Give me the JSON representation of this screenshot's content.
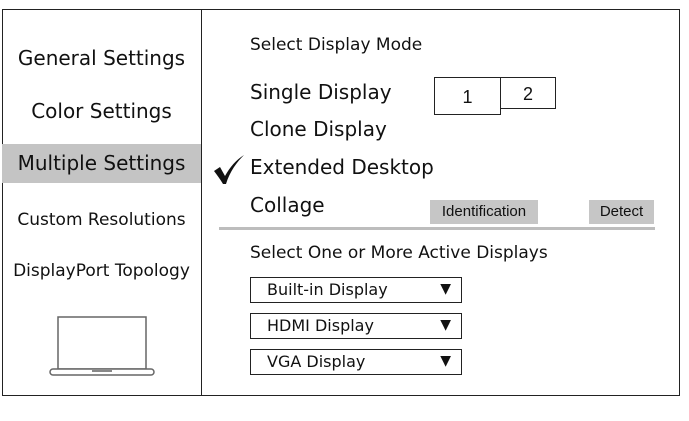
{
  "sidebar": {
    "items": [
      {
        "label": "General Settings"
      },
      {
        "label": "Color Settings"
      },
      {
        "label": "Multiple Settings"
      },
      {
        "label": "Custom Resolutions"
      },
      {
        "label": "DisplayPort Topology"
      }
    ],
    "active_index": 2,
    "icon": "laptop-icon"
  },
  "main": {
    "mode_heading": "Select Display Mode",
    "modes": [
      {
        "label": "Single Display"
      },
      {
        "label": "Clone Display"
      },
      {
        "label": "Extended Desktop",
        "selected": true
      },
      {
        "label": "Collage"
      }
    ],
    "displays": [
      "1",
      "2"
    ],
    "identification_label": "Identification",
    "detect_label": "Detect",
    "active_heading": "Select One or More Active Displays",
    "dropdowns": [
      {
        "value": "Built-in Display"
      },
      {
        "value": "HDMI Display"
      },
      {
        "value": "VGA Display"
      }
    ],
    "dropdown_arrow": "▼",
    "check_icon": "checkmark-icon"
  },
  "colors": {
    "active_bg": "#c4c4c4",
    "button_bg": "#c6c6c6",
    "divider": "#bdbdbd"
  }
}
